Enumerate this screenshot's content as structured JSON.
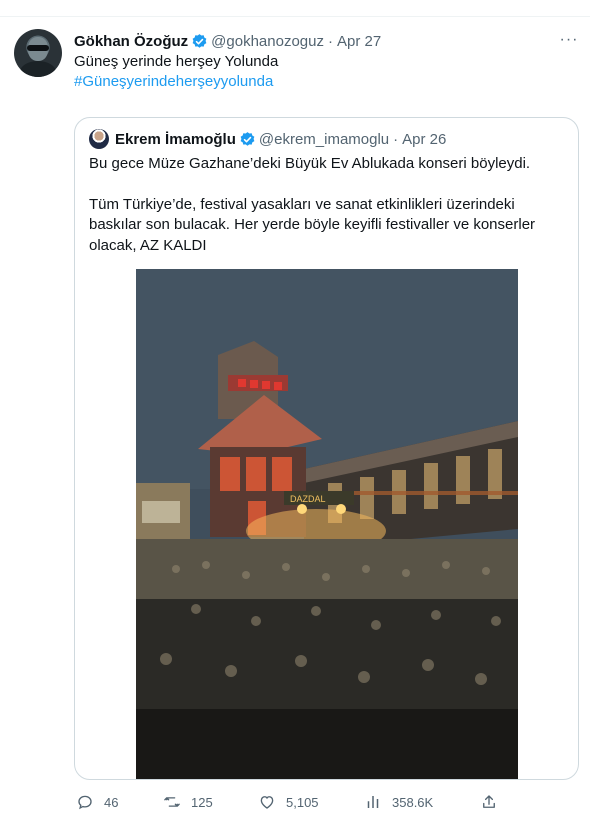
{
  "tweet": {
    "author_name": "Gökhan Özoğuz",
    "handle": "@gokhanozoguz",
    "separator": "·",
    "date": "Apr 27",
    "text": "Güneş yerinde herşey Yolunda",
    "hashtag": "#Güneşyerindeherşeyyolunda",
    "more_label": "···"
  },
  "quote": {
    "author_name": "Ekrem İmamoğlu",
    "handle": "@ekrem_imamoglu",
    "separator": "·",
    "date": "Apr 26",
    "line1": "Bu gece Müze Gazhane’deki Büyük Ev Ablukada konseri böyleydi.",
    "line2": "Tüm Türkiye’de, festival yasakları ve sanat etkinlikleri üzerindeki baskılar son bulacak. Her yerde böyle keyifli festivaller ve konserler olacak, AZ KALDI"
  },
  "actions": {
    "replies": "46",
    "retweets": "125",
    "likes": "5,105",
    "views": "358.6K"
  },
  "colors": {
    "accent": "#1d9bf0",
    "muted": "#536471",
    "border": "#cfd9de"
  },
  "icons": [
    "verified-badge-icon",
    "more-icon",
    "reply-icon",
    "retweet-icon",
    "like-icon",
    "views-icon",
    "share-icon"
  ]
}
